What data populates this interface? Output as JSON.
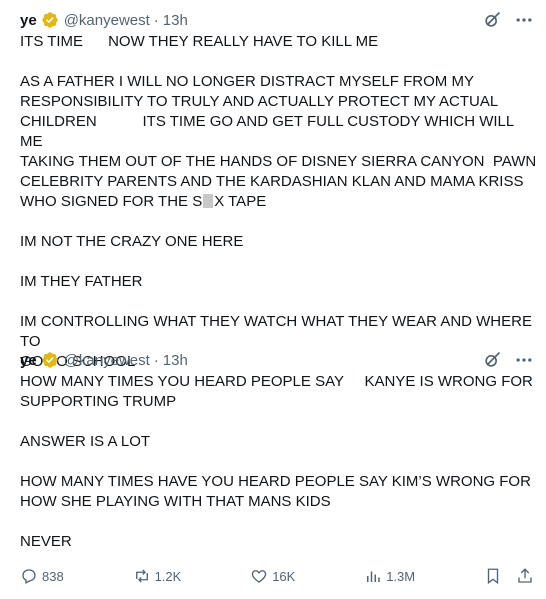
{
  "tweets": [
    {
      "display_name": "ye",
      "handle": "@kanyewest",
      "separator": "·",
      "time": "13h",
      "lines": [
        "ITS TIME      NOW THEY REALLY HAVE TO KILL ME",
        "",
        "AS A FATHER I WILL NO LONGER DISTRACT MYSELF FROM MY",
        "RESPONSIBILITY TO TRULY AND ACTUALLY PROTECT MY ACTUAL",
        "CHILDREN           ITS TIME GO AND GET FULL CUSTODY WHICH WILL ME",
        "TAKING THEM OUT OF THE HANDS OF DISNEY SIERRA CANYON  PAWN",
        "CELEBRITY PARENTS AND THE KARDASHIAN KLAN AND MAMA KRISS"
      ],
      "redacted_line_start": "WHO SIGNED FOR THE S",
      "redacted_line_end": "X TAPE",
      "lines_after": [
        "",
        "IM NOT THE CRAZY ONE HERE",
        "",
        "IM THEY FATHER",
        "",
        "IM CONTROLLING WHAT THEY WATCH WHAT THEY WEAR AND WHERE TO",
        "GO TO SCHOOL"
      ]
    },
    {
      "display_name": "ye",
      "handle": "@kanyewest",
      "separator": "·",
      "time": "13h",
      "text": "HOW MANY TIMES YOU HEARD PEOPLE SAY     KANYE IS WRONG FOR\nSUPPORTING TRUMP\n\nANSWER IS A LOT\n\nHOW MANY TIMES HAVE YOU HEARD PEOPLE SAY KIM’S WRONG FOR\nHOW SHE PLAYING WITH THAT MANS KIDS\n\nNEVER"
    }
  ],
  "actions": {
    "replies": "838",
    "reposts": "1.2K",
    "likes": "16K",
    "views": "1.3M"
  },
  "colors": {
    "text": "#0f1419",
    "secondary": "#536471",
    "verified_gold": "#e2b719"
  }
}
